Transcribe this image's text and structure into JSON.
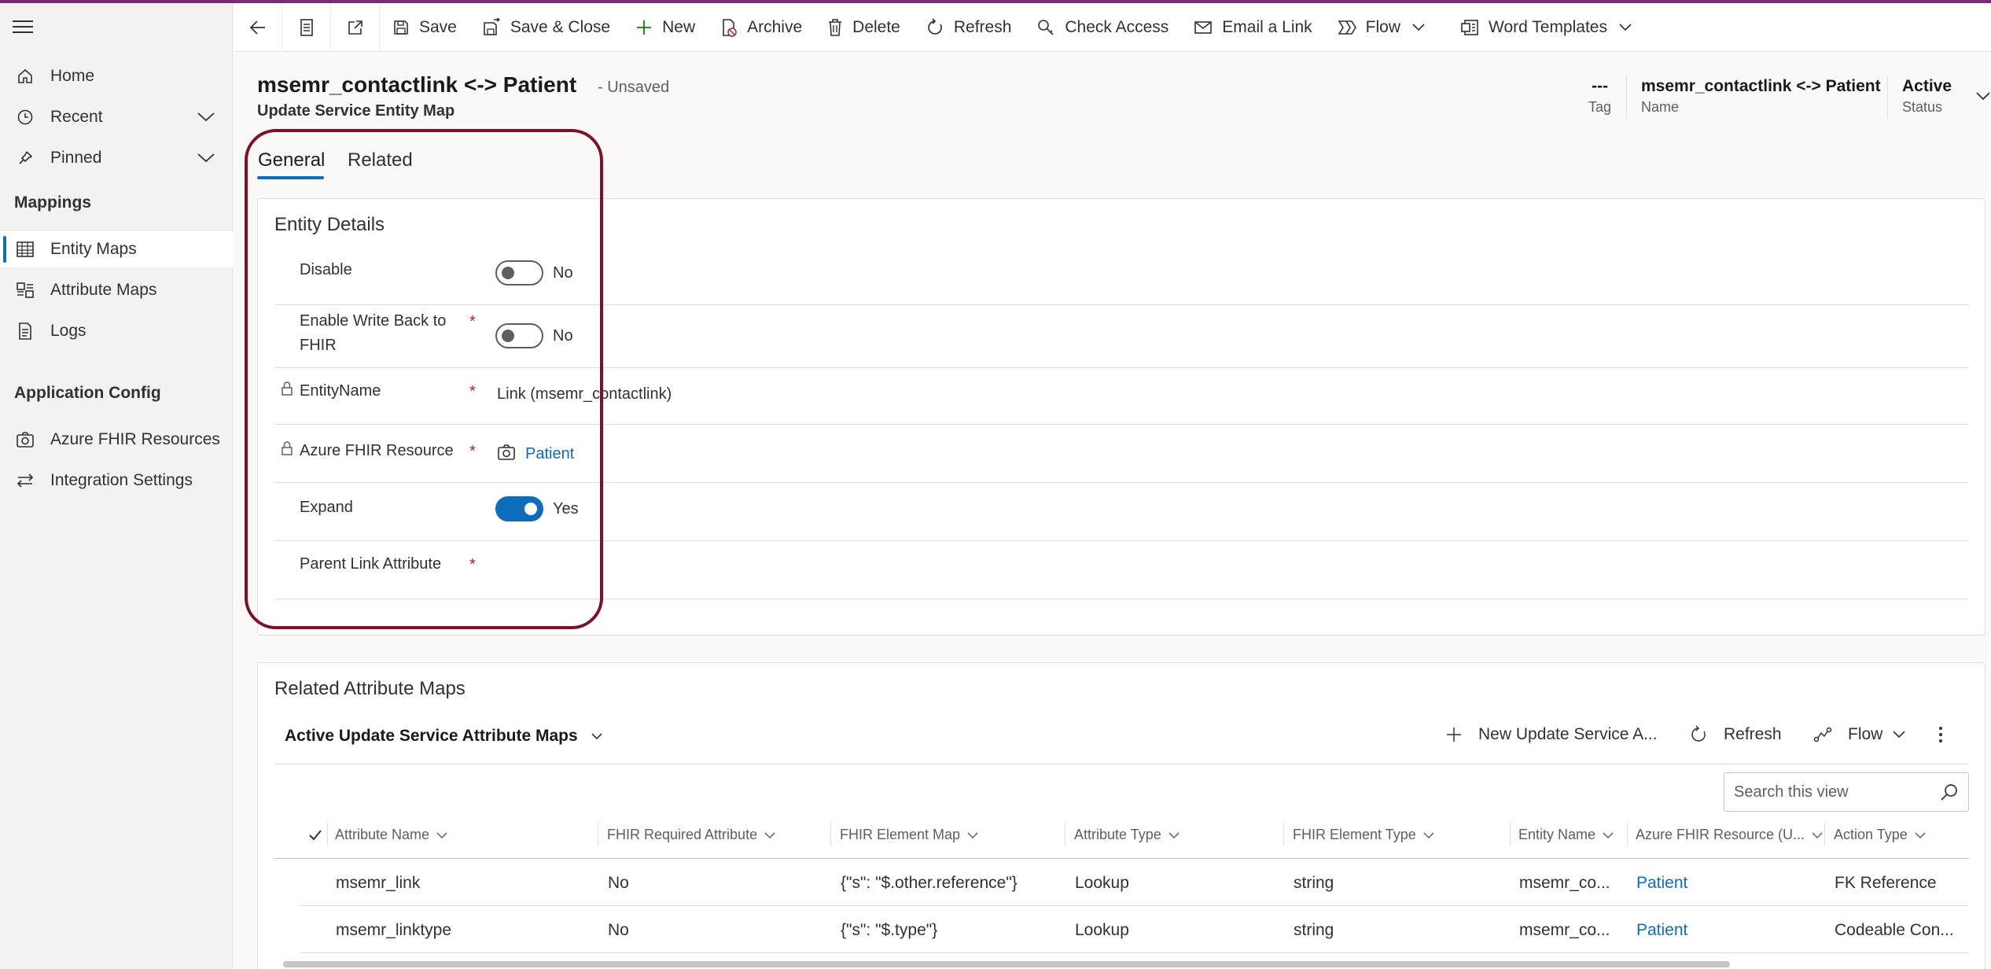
{
  "sidebar": {
    "items": [
      {
        "label": "Home",
        "icon": "home-icon"
      },
      {
        "label": "Recent",
        "icon": "clock-icon"
      },
      {
        "label": "Pinned",
        "icon": "pin-icon"
      }
    ],
    "sections": [
      {
        "title": "Mappings",
        "items": [
          {
            "label": "Entity Maps",
            "icon": "table-icon",
            "active": true
          },
          {
            "label": "Attribute Maps",
            "icon": "attribute-map-icon"
          },
          {
            "label": "Logs",
            "icon": "document-icon"
          }
        ]
      },
      {
        "title": "Application Config",
        "items": [
          {
            "label": "Azure FHIR Resources",
            "icon": "camera-icon"
          },
          {
            "label": "Integration Settings",
            "icon": "arrows-icon"
          }
        ]
      }
    ]
  },
  "toolbar": {
    "save": "Save",
    "save_close": "Save & Close",
    "new": "New",
    "archive": "Archive",
    "delete": "Delete",
    "refresh": "Refresh",
    "check_access": "Check Access",
    "email_link": "Email a Link",
    "flow": "Flow",
    "word_templates": "Word Templates"
  },
  "header": {
    "title": "msemr_contactlink <-> Patient",
    "unsaved": "- Unsaved",
    "subtitle": "Update Service Entity Map",
    "fields": [
      {
        "value": "---",
        "label": "Tag"
      },
      {
        "value": "msemr_contactlink <-> Patient",
        "label": "Name"
      },
      {
        "value": "Active",
        "label": "Status"
      }
    ]
  },
  "tabs": [
    "General",
    "Related"
  ],
  "entity_details": {
    "title": "Entity Details",
    "disable": {
      "label": "Disable",
      "value": "No",
      "on": false
    },
    "write_back": {
      "label_line1": "Enable Write Back to",
      "label_line2": "FHIR",
      "value": "No",
      "on": false
    },
    "entity_name": {
      "label": "EntityName",
      "value": "Link (msemr_contactlink)"
    },
    "fhir_resource": {
      "label": "Azure FHIR Resource",
      "value": "Patient"
    },
    "expand": {
      "label": "Expand",
      "value": "Yes",
      "on": true
    },
    "parent_link": {
      "label": "Parent Link Attribute",
      "value": ""
    },
    "required_mark": "*"
  },
  "related": {
    "title": "Related Attribute Maps",
    "view": "Active Update Service Attribute Maps",
    "new_btn": "New Update Service A...",
    "refresh": "Refresh",
    "flow": "Flow",
    "search_placeholder": "Search this view",
    "columns": [
      "Attribute Name",
      "FHIR Required Attribute",
      "FHIR Element Map",
      "Attribute Type",
      "FHIR Element Type",
      "Entity Name",
      "Azure FHIR Resource (U...",
      "Action Type"
    ],
    "rows": [
      [
        "msemr_link",
        "No",
        "{\"s\": \"$.other.reference\"}",
        "Lookup",
        "string",
        "msemr_co...",
        "Patient",
        "FK Reference"
      ],
      [
        "msemr_linktype",
        "No",
        "{\"s\": \"$.type\"}",
        "Lookup",
        "string",
        "msemr_co...",
        "Patient",
        "Codeable Con..."
      ]
    ]
  }
}
